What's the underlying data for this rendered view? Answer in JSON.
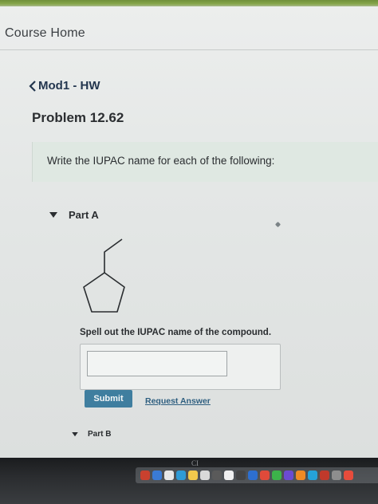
{
  "header": {
    "course_home": "Course Home"
  },
  "breadcrumb": {
    "label": "Mod1 - HW"
  },
  "problem": {
    "title": "Problem 12.62"
  },
  "instruction": {
    "text": "Write the IUPAC name for each of the following:"
  },
  "part_a": {
    "label": "Part A",
    "prompt": "Spell out the IUPAC name of the compound.",
    "answer_value": "",
    "submit_label": "Submit",
    "request_label": "Request Answer"
  },
  "part_b": {
    "label": "Part B"
  },
  "monitor": {
    "logo": "CI"
  },
  "colors": {
    "accent_green": "#86a64b",
    "submit_blue": "#3f7e9f",
    "instruction_bg": "#dfe8e2"
  },
  "icons": [
    "chevron-left-icon",
    "triangle-down-icon",
    "dock-app-icons"
  ]
}
